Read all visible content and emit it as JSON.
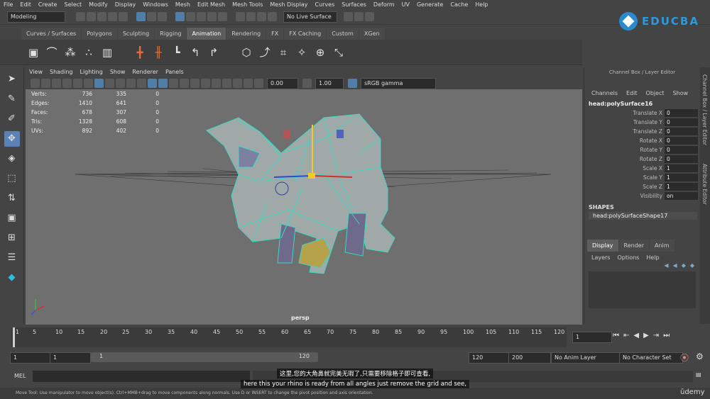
{
  "menubar": [
    "File",
    "Edit",
    "Create",
    "Select",
    "Modify",
    "Display",
    "Windows",
    "Mesh",
    "Edit Mesh",
    "Mesh Tools",
    "Mesh Display",
    "Curves",
    "Surfaces",
    "Deform",
    "UV",
    "Generate",
    "Cache",
    "Help"
  ],
  "status": {
    "mode": "Modeling",
    "live_surface": "No Live Surface"
  },
  "logo": {
    "text": "EDUCBA"
  },
  "shelf_tabs": [
    "Curves / Surfaces",
    "Polygons",
    "Sculpting",
    "Rigging",
    "Animation",
    "Rendering",
    "FX",
    "FX Caching",
    "Custom",
    "XGen"
  ],
  "shelf_active": "Animation",
  "viewport": {
    "menus": [
      "View",
      "Shading",
      "Lighting",
      "Show",
      "Renderer",
      "Panels"
    ],
    "value1": "0.00",
    "value2": "1.00",
    "color_space": "sRGB gamma",
    "camera_label": "persp",
    "hud": [
      {
        "label": "Verts:",
        "a": "736",
        "b": "335",
        "c": "0"
      },
      {
        "label": "Edges:",
        "a": "1410",
        "b": "641",
        "c": "0"
      },
      {
        "label": "Faces:",
        "a": "678",
        "b": "307",
        "c": "0"
      },
      {
        "label": "Tris:",
        "a": "1328",
        "b": "608",
        "c": "0"
      },
      {
        "label": "UVs:",
        "a": "892",
        "b": "402",
        "c": "0"
      }
    ]
  },
  "channel_box": {
    "title": "Channel Box / Layer Editor",
    "menus": [
      "Channels",
      "Edit",
      "Object",
      "Show"
    ],
    "object": "head:polySurface16",
    "attrs": [
      {
        "label": "Translate X",
        "value": "0"
      },
      {
        "label": "Translate Y",
        "value": "0"
      },
      {
        "label": "Translate Z",
        "value": "0"
      },
      {
        "label": "Rotate X",
        "value": "0"
      },
      {
        "label": "Rotate Y",
        "value": "0"
      },
      {
        "label": "Rotate Z",
        "value": "0"
      },
      {
        "label": "Scale X",
        "value": "1"
      },
      {
        "label": "Scale Y",
        "value": "1"
      },
      {
        "label": "Scale Z",
        "value": "1"
      },
      {
        "label": "Visibility",
        "value": "on"
      }
    ],
    "shapes_header": "SHAPES",
    "shape": "head:polySurfaceShape17",
    "layer_tabs": [
      "Display",
      "Render",
      "Anim"
    ],
    "layer_menus": [
      "Layers",
      "Options",
      "Help"
    ]
  },
  "side_tabs": [
    "Channel Box / Layer Editor",
    "Attribute Editor"
  ],
  "timeline": {
    "ticks": [
      "1",
      "5",
      "10",
      "15",
      "20",
      "25",
      "30",
      "35",
      "40",
      "45",
      "50",
      "55",
      "60",
      "65",
      "70",
      "75",
      "80",
      "85",
      "90",
      "95",
      "100",
      "105",
      "110",
      "115",
      "120"
    ],
    "current_frame": "1"
  },
  "range": {
    "start": "1",
    "start2": "1",
    "slider_start": "1",
    "slider_end": "120",
    "end": "120",
    "end2": "200",
    "anim_layer": "No Anim Layer",
    "char_set": "No Character Set"
  },
  "mel": {
    "label": "MEL"
  },
  "subtitles": {
    "cn": "这里,您的大角鼻就完美无瑕了,只需要移除格子即可查看,",
    "en": "here this your rhino is ready from all angles just remove the grid and see,"
  },
  "helpline": "Move Tool: Use manipulator to move object(s). Ctrl+MMB+drag to move components along normals. Use D or INSERT to change the pivot position and axis orientation.",
  "watermark": "ūdemy",
  "colors": {
    "accent": "#5b82b4",
    "mesh_wire": "#3fd6c2",
    "viewport_bg": "#6f6f6f"
  }
}
